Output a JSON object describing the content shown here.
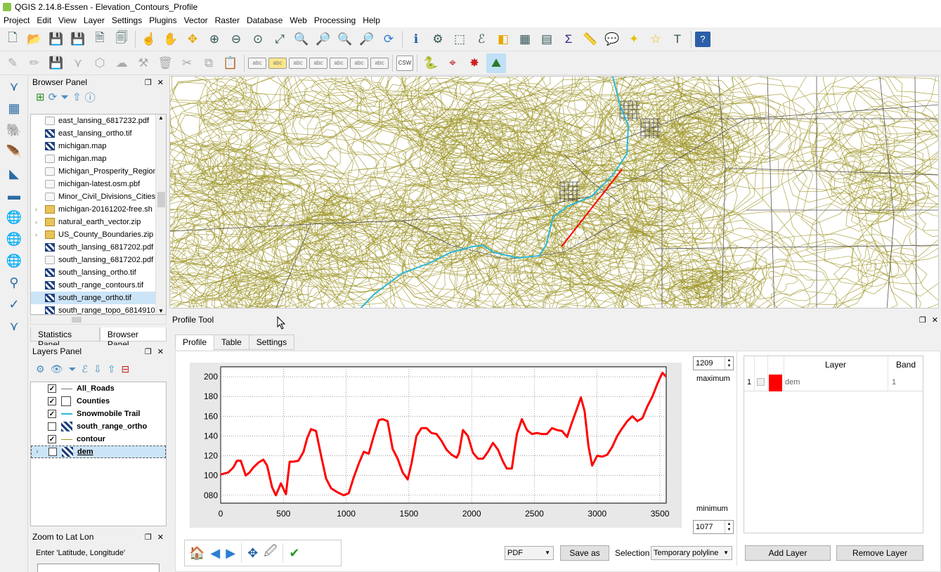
{
  "window": {
    "title": "QGIS 2.14.8-Essen - Elevation_Contours_Profile"
  },
  "menubar": [
    "Project",
    "Edit",
    "View",
    "Layer",
    "Settings",
    "Plugins",
    "Vector",
    "Raster",
    "Database",
    "Web",
    "Processing",
    "Help"
  ],
  "toolbar2": {
    "csw_label": "CSW",
    "abc_label": "abc"
  },
  "browser_panel": {
    "title": "Browser Panel",
    "items": [
      {
        "label": "east_lansing_6817232.pdf",
        "icon": "file-icon"
      },
      {
        "label": "east_lansing_ortho.tif",
        "icon": "raster-icon"
      },
      {
        "label": "michigan.map",
        "icon": "raster-icon"
      },
      {
        "label": "michigan.map",
        "icon": "file-icon"
      },
      {
        "label": "Michigan_Prosperity_Region",
        "icon": "file-icon"
      },
      {
        "label": "michigan-latest.osm.pbf",
        "icon": "file-icon"
      },
      {
        "label": "Minor_Civil_Divisions_Cities_",
        "icon": "file-icon"
      },
      {
        "label": "michigan-20161202-free.sh",
        "icon": "zip-icon",
        "expandable": true
      },
      {
        "label": "natural_earth_vector.zip",
        "icon": "zip-icon",
        "expandable": true
      },
      {
        "label": "US_County_Boundaries.zip",
        "icon": "zip-icon",
        "expandable": true
      },
      {
        "label": "south_lansing_6817202.pdf",
        "icon": "raster-icon"
      },
      {
        "label": "south_lansing_6817202.pdf",
        "icon": "file-icon"
      },
      {
        "label": "south_lansing_ortho.tif",
        "icon": "raster-icon"
      },
      {
        "label": "south_range_contours.tif",
        "icon": "raster-icon"
      },
      {
        "label": "south_range_ortho.tif",
        "icon": "raster-icon",
        "selected": true
      },
      {
        "label": "south_range_topo_6814910",
        "icon": "raster-icon"
      }
    ]
  },
  "panel_tabs": [
    "Statistics Panel",
    "Browser Panel"
  ],
  "layers_panel": {
    "title": "Layers Panel",
    "items": [
      {
        "label": "All_Roads",
        "checked": true,
        "symbol": "line-gray"
      },
      {
        "label": "Counties",
        "checked": true,
        "symbol": "box"
      },
      {
        "label": "Snowmobile Trail",
        "checked": true,
        "symbol": "line-cyan"
      },
      {
        "label": "south_range_ortho",
        "checked": false,
        "symbol": "raster"
      },
      {
        "label": "contour",
        "checked": true,
        "symbol": "line-olive"
      },
      {
        "label": "dem",
        "checked": false,
        "symbol": "raster",
        "selected": true,
        "expandable": true
      }
    ]
  },
  "zoom_panel": {
    "title": "Zoom to Lat Lon",
    "label": "Enter 'Latitude, Longitude'"
  },
  "profile_tool": {
    "title": "Profile Tool",
    "tabs": [
      "Profile",
      "Table",
      "Settings"
    ],
    "max_value": "1209",
    "max_label": "maximum",
    "min_value": "1077",
    "min_label": "minimum",
    "table_headers": {
      "layer": "Layer",
      "band": "Band"
    },
    "table_row": {
      "index": "1",
      "layer": "dem",
      "band": "1",
      "color": "#ff0000"
    },
    "add_layer": "Add Layer",
    "remove_layer": "Remove Layer",
    "format": "PDF",
    "save_as": "Save as",
    "selection_label": "Selection",
    "selection_value": "Temporary polyline"
  },
  "colors": {
    "contour": "#a0962a",
    "trail": "#2ab8d8",
    "profile_line": "#ff0000",
    "road": "#555555"
  },
  "chart_data": {
    "type": "line",
    "xlim": [
      0,
      3550
    ],
    "ylim": [
      72,
      210
    ],
    "xticks": [
      0,
      500,
      1000,
      1500,
      2000,
      2500,
      3000,
      3500
    ],
    "yticks": [
      80,
      100,
      120,
      140,
      160,
      180,
      200
    ],
    "ytick_labels": [
      "080",
      "100",
      "120",
      "140",
      "160",
      "180",
      "200"
    ],
    "grid": true,
    "series": [
      {
        "color": "#ff0000",
        "x": [
          0,
          60,
          100,
          130,
          160,
          200,
          230,
          260,
          300,
          340,
          370,
          410,
          440,
          480,
          520,
          550,
          580,
          620,
          660,
          690,
          720,
          760,
          800,
          840,
          880,
          930,
          980,
          1020,
          1060,
          1100,
          1140,
          1180,
          1220,
          1260,
          1290,
          1330,
          1370,
          1410,
          1450,
          1490,
          1520,
          1560,
          1600,
          1640,
          1680,
          1720,
          1760,
          1800,
          1840,
          1880,
          1900,
          1930,
          1970,
          2010,
          2050,
          2090,
          2130,
          2170,
          2210,
          2250,
          2280,
          2320,
          2360,
          2400,
          2440,
          2480,
          2520,
          2560,
          2600,
          2640,
          2680,
          2720,
          2760,
          2800,
          2840,
          2870,
          2900,
          2930,
          2960,
          3000,
          3040,
          3080,
          3120,
          3160,
          3200,
          3240,
          3280,
          3320,
          3360,
          3400,
          3440,
          3480,
          3520,
          3550
        ],
        "y": [
          101,
          103,
          108,
          115,
          115,
          100,
          103,
          108,
          113,
          116,
          110,
          88,
          80,
          92,
          81,
          114,
          114,
          115,
          124,
          138,
          147,
          145,
          120,
          97,
          87,
          83,
          80,
          82,
          98,
          112,
          124,
          122,
          140,
          156,
          157,
          155,
          127,
          117,
          103,
          96,
          112,
          140,
          148,
          148,
          143,
          142,
          135,
          126,
          121,
          118,
          123,
          146,
          140,
          123,
          117,
          117,
          124,
          133,
          126,
          114,
          107,
          107,
          142,
          157,
          146,
          142,
          143,
          142,
          142,
          148,
          146,
          145,
          139,
          154,
          168,
          179,
          165,
          130,
          110,
          120,
          119,
          121,
          129,
          140,
          148,
          155,
          160,
          155,
          158,
          170,
          180,
          193,
          204,
          200
        ]
      }
    ]
  }
}
